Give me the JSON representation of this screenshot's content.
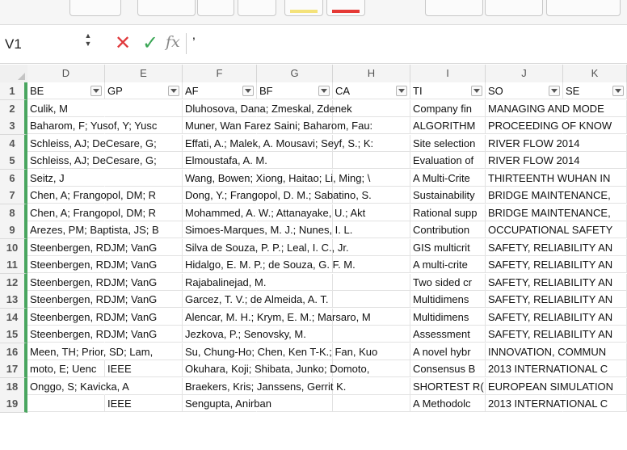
{
  "formula_bar": {
    "cell_ref": "V1",
    "formula": "’"
  },
  "icons": {
    "cancel": "close-icon",
    "enter": "checkmark-icon",
    "function": "fx-icon",
    "stepper": "stepper-icon",
    "filter": "chevron-down-icon"
  },
  "colors": {
    "cancel": "#e0383b",
    "enter": "#3aa655",
    "active_row_marker": "#49a55f",
    "toolbar_red": "#e53935",
    "toolbar_yellow": "#f4e27a"
  },
  "columns": [
    "D",
    "E",
    "F",
    "G",
    "H",
    "I",
    "J",
    "K"
  ],
  "rows": [
    {
      "num": "1",
      "cells": [
        "BE",
        "GP",
        "AF",
        "BF",
        "CA",
        "TI",
        "SO",
        "SE"
      ]
    },
    {
      "num": "2",
      "cells": [
        "Culik, M",
        "",
        "Dluhosova, Dana; Zmeskal, Zdenek",
        "",
        "",
        "Company fin",
        "MANAGING AND MODE",
        ""
      ]
    },
    {
      "num": "3",
      "cells": [
        "Baharom, F; Yusof, Y; Yusc",
        "",
        "Muner, Wan Farez Saini; Baharom, Fau:",
        "",
        "",
        "ALGORITHM",
        "PROCEEDING OF KNOW",
        ""
      ]
    },
    {
      "num": "4",
      "cells": [
        "Schleiss, AJ; DeCesare, G;",
        "",
        "Effati, A.; Malek, A. Mousavi; Seyf, S.; K:",
        "",
        "",
        "Site selection",
        "RIVER FLOW 2014",
        ""
      ]
    },
    {
      "num": "5",
      "cells": [
        "Schleiss, AJ; DeCesare, G;",
        "",
        "Elmoustafa, A. M.",
        "",
        "",
        "Evaluation of",
        "RIVER FLOW 2014",
        ""
      ]
    },
    {
      "num": "6",
      "cells": [
        "Seitz, J",
        "",
        "Wang, Bowen; Xiong, Haitao; Li, Ming; \\",
        "",
        "",
        "A Multi-Crite",
        "THIRTEENTH WUHAN IN",
        ""
      ]
    },
    {
      "num": "7",
      "cells": [
        "Chen, A; Frangopol, DM; R",
        "",
        "Dong, Y.; Frangopol, D. M.; Sabatino, S.",
        "",
        "",
        "Sustainability",
        "BRIDGE MAINTENANCE,",
        ""
      ]
    },
    {
      "num": "8",
      "cells": [
        "Chen, A; Frangopol, DM; R",
        "",
        "Mohammed, A. W.; Attanayake, U.; Akt",
        "",
        "",
        "Rational supp",
        "BRIDGE MAINTENANCE,",
        ""
      ]
    },
    {
      "num": "9",
      "cells": [
        "Arezes, PM; Baptista, JS; B",
        "",
        "Simoes-Marques, M. J.; Nunes, I. L.",
        "",
        "",
        "Contribution",
        "OCCUPATIONAL SAFETY",
        ""
      ]
    },
    {
      "num": "10",
      "cells": [
        "Steenbergen, RDJM; VanG",
        "",
        "Silva de Souza, P. P.; Leal, I. C., Jr.",
        "",
        "",
        "GIS multicrit",
        "SAFETY, RELIABILITY AN",
        ""
      ]
    },
    {
      "num": "11",
      "cells": [
        "Steenbergen, RDJM; VanG",
        "",
        "Hidalgo, E. M. P.; de Souza, G. F. M.",
        "",
        "",
        "A multi-crite",
        "SAFETY, RELIABILITY AN",
        ""
      ]
    },
    {
      "num": "12",
      "cells": [
        "Steenbergen, RDJM; VanG",
        "",
        "Rajabalinejad, M.",
        "",
        "",
        "Two sided cr",
        "SAFETY, RELIABILITY AN",
        ""
      ]
    },
    {
      "num": "13",
      "cells": [
        "Steenbergen, RDJM; VanG",
        "",
        "Garcez, T. V.; de Almeida, A. T.",
        "",
        "",
        "Multidimens",
        "SAFETY, RELIABILITY AN",
        ""
      ]
    },
    {
      "num": "14",
      "cells": [
        "Steenbergen, RDJM; VanG",
        "",
        "Alencar, M. H.; Krym, E. M.; Marsaro, M",
        "",
        "",
        "Multidimens",
        "SAFETY, RELIABILITY AN",
        ""
      ]
    },
    {
      "num": "15",
      "cells": [
        "Steenbergen, RDJM; VanG",
        "",
        "Jezkova, P.; Senovsky, M.",
        "",
        "",
        "Assessment",
        "SAFETY, RELIABILITY AN",
        ""
      ]
    },
    {
      "num": "16",
      "cells": [
        "Meen, TH; Prior, SD; Lam,",
        "",
        "Su, Chung-Ho; Chen, Ken T-K.; Fan, Kuo",
        "",
        "",
        "A novel hybr",
        "INNOVATION, COMMUN",
        ""
      ]
    },
    {
      "num": "17",
      "cells": [
        "moto, E; Uenc",
        "IEEE",
        "Okuhara, Koji; Shibata, Junko; Domoto,",
        "",
        "",
        "Consensus B",
        "2013 INTERNATIONAL C",
        ""
      ]
    },
    {
      "num": "18",
      "cells": [
        "Onggo, S; Kavicka, A",
        "",
        "Braekers, Kris; Janssens, Gerrit K.",
        "",
        "",
        "SHORTEST R(",
        "EUROPEAN SIMULATION",
        ""
      ]
    },
    {
      "num": "19",
      "cells": [
        "",
        "IEEE",
        "Sengupta, Anirban",
        "",
        "",
        "A Methodolc",
        "2013 INTERNATIONAL C",
        ""
      ]
    }
  ]
}
